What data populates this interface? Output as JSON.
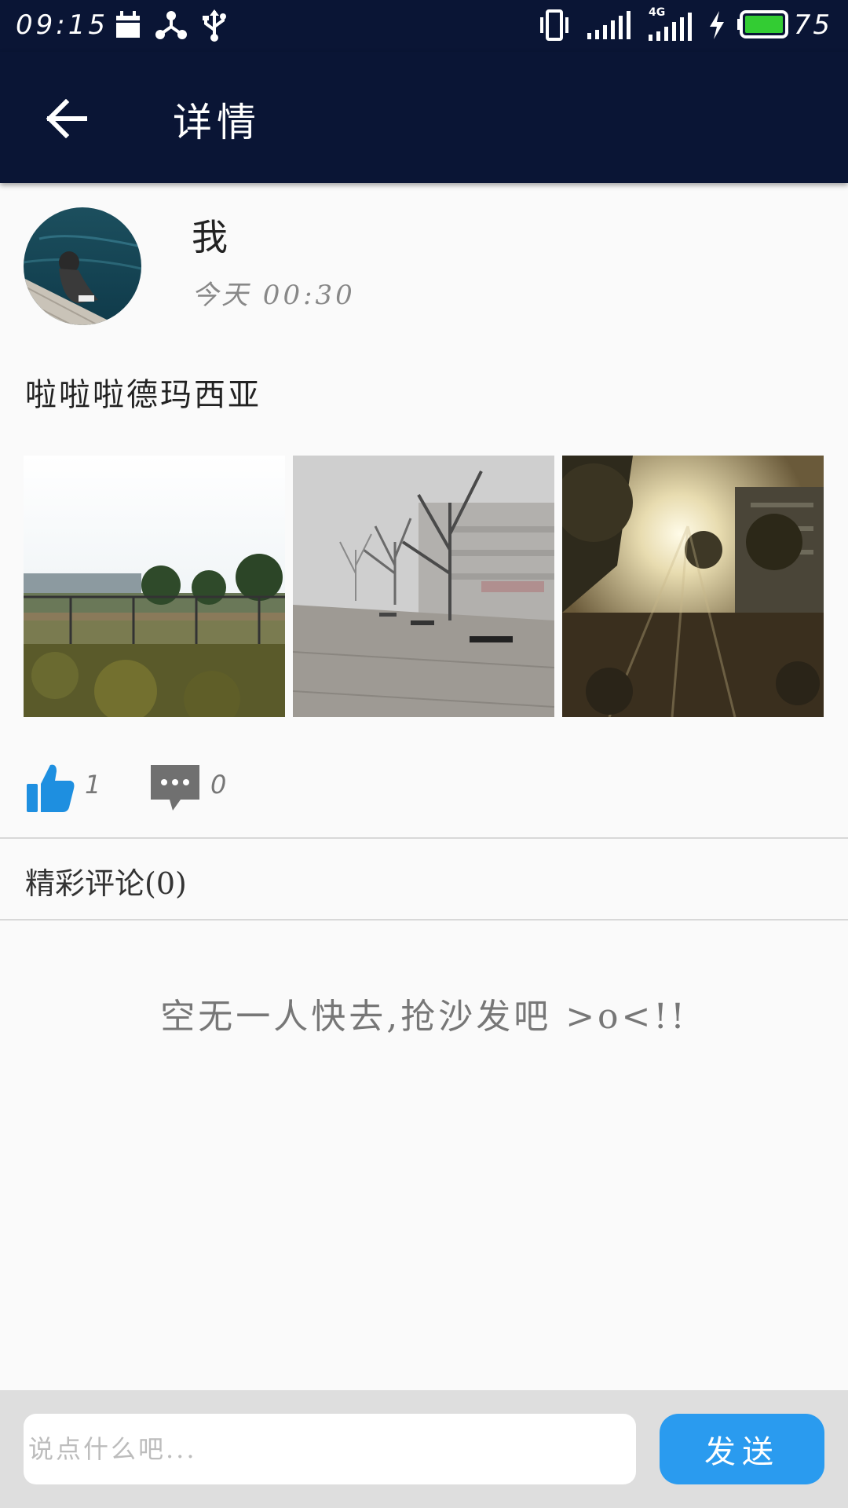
{
  "status_bar": {
    "time": "09:15",
    "battery_percent": "75",
    "network_label": "4G",
    "icons": [
      "calendar-icon",
      "share-network-icon",
      "usb-icon",
      "vibrate-icon",
      "signal-icon",
      "signal-4g-icon",
      "charging-icon",
      "battery-icon"
    ]
  },
  "app_bar": {
    "title": "详情",
    "back_icon": "arrow-left-icon"
  },
  "post": {
    "author": "我",
    "time": "今天 00:30",
    "text": "啦啦啦德玛西亚",
    "images": [
      "sports-field-photo",
      "foggy-campus-photo",
      "sunrise-trees-photo"
    ],
    "likes": "1",
    "comments": "0"
  },
  "comments": {
    "header": "精彩评论(0)",
    "empty_message": "空无一人快去,抢沙发吧 >o<!!"
  },
  "input_bar": {
    "placeholder": "说点什么吧...",
    "send_label": "发送"
  },
  "colors": {
    "app_bar": "#0a1535",
    "accent": "#2a9bef",
    "like_icon": "#1e8fe0",
    "comment_icon": "#707070",
    "battery": "#33cc33"
  }
}
